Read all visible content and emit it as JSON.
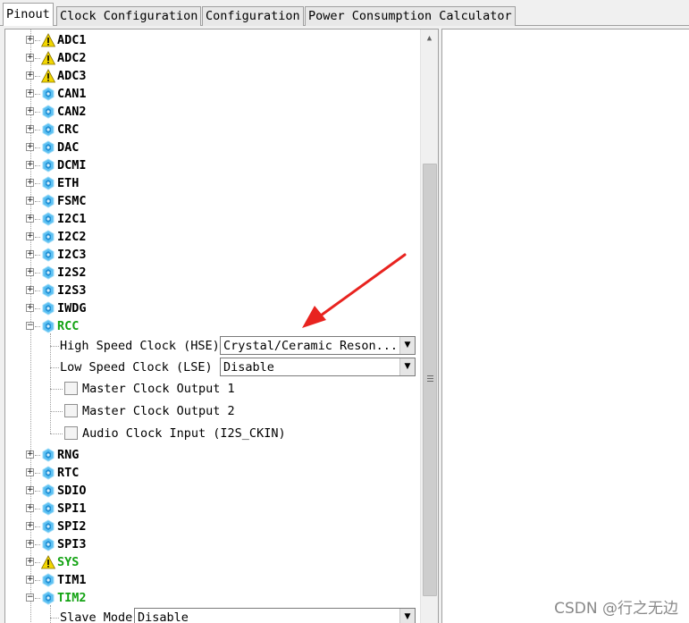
{
  "tabs": [
    {
      "label": "Pinout",
      "active": true
    },
    {
      "label": "Clock Configuration",
      "active": false
    },
    {
      "label": "Configuration",
      "active": false
    },
    {
      "label": "Power Consumption Calculator",
      "active": false
    }
  ],
  "tree": {
    "nodes_top": [
      {
        "label": "ADC1",
        "icon": "warning-icon"
      },
      {
        "label": "ADC2",
        "icon": "warning-icon"
      },
      {
        "label": "ADC3",
        "icon": "warning-icon"
      },
      {
        "label": "CAN1",
        "icon": "peripheral-icon"
      },
      {
        "label": "CAN2",
        "icon": "peripheral-icon"
      },
      {
        "label": "CRC",
        "icon": "peripheral-icon"
      },
      {
        "label": "DAC",
        "icon": "peripheral-icon"
      },
      {
        "label": "DCMI",
        "icon": "peripheral-icon"
      },
      {
        "label": "ETH",
        "icon": "peripheral-icon"
      },
      {
        "label": "FSMC",
        "icon": "peripheral-icon"
      },
      {
        "label": "I2C1",
        "icon": "peripheral-icon"
      },
      {
        "label": "I2C2",
        "icon": "peripheral-icon"
      },
      {
        "label": "I2C3",
        "icon": "peripheral-icon"
      },
      {
        "label": "I2S2",
        "icon": "peripheral-icon"
      },
      {
        "label": "I2S3",
        "icon": "peripheral-icon"
      },
      {
        "label": "IWDG",
        "icon": "peripheral-icon"
      }
    ],
    "rcc": {
      "label": "RCC",
      "icon": "peripheral-icon",
      "expanded": true,
      "hse_label": "High Speed Clock (HSE)",
      "hse_value": "Crystal/Ceramic Reson...",
      "lse_label": "Low Speed Clock (LSE)",
      "lse_value": "Disable",
      "mco1_label": "Master Clock Output 1",
      "mco1_checked": false,
      "mco2_label": "Master Clock Output 2",
      "mco2_checked": false,
      "i2s_label": "Audio Clock Input (I2S_CKIN)",
      "i2s_checked": false
    },
    "nodes_bottom": [
      {
        "label": "RNG",
        "icon": "peripheral-icon"
      },
      {
        "label": "RTC",
        "icon": "peripheral-icon"
      },
      {
        "label": "SDIO",
        "icon": "peripheral-icon"
      },
      {
        "label": "SPI1",
        "icon": "peripheral-icon"
      },
      {
        "label": "SPI2",
        "icon": "peripheral-icon"
      },
      {
        "label": "SPI3",
        "icon": "peripheral-icon"
      }
    ],
    "sys": {
      "label": "SYS",
      "icon": "warning-icon"
    },
    "tim1": {
      "label": "TIM1",
      "icon": "peripheral-icon"
    },
    "tim2": {
      "label": "TIM2",
      "icon": "peripheral-icon",
      "slave_label": "Slave Mode",
      "slave_value": "Disable"
    }
  },
  "colors": {
    "enabled_green": "#13a313",
    "annotation_red": "#e8231f",
    "warning_yellow": "#f2d600",
    "peripheral_blue": "#37a8e6"
  },
  "watermark": "CSDN @行之无边"
}
